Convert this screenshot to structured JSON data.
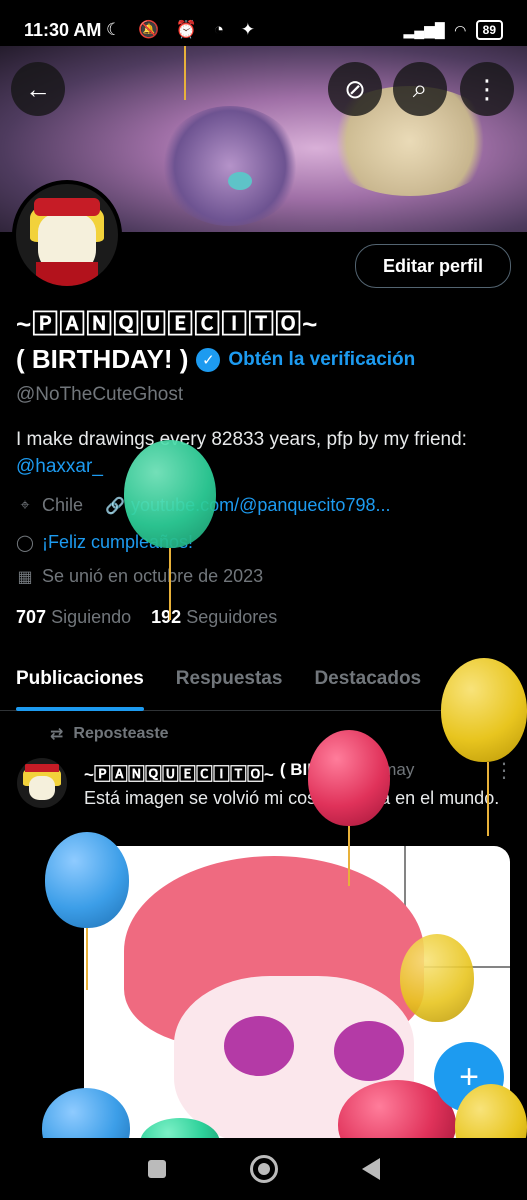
{
  "status_bar": {
    "time": "11:30 AM",
    "left_icons": [
      "moon-icon",
      "bell-off-icon",
      "alarm-icon",
      "whatsapp-icon",
      "game-icon"
    ],
    "battery": "89"
  },
  "top_buttons": {
    "back_icon": "←",
    "hide_icon": "⊘",
    "search_icon": "⌕",
    "more_icon": "⋮"
  },
  "profile": {
    "edit_label": "Editar perfil",
    "name_line1": "~🄿🄰🄽🅀🅄🄴🄲🄸🅃🄾~",
    "name_line2": "( BIRTHDAY! )",
    "verified_icon": "✓",
    "verify_link": "Obtén la verificación",
    "handle": "@NoTheCuteGhost",
    "bio_text": "I make drawings every 82833 years, pfp by my friend:",
    "bio_mention": "@haxxar_",
    "location": "Chile",
    "website": "youtube.com/@panquecito798...",
    "birthday": "¡Feliz cumpleaños!",
    "joined": "Se unió en octubre de 2023",
    "following_count": "707",
    "following_label": "Siguiendo",
    "followers_count": "192",
    "followers_label": "Seguidores"
  },
  "tabs": [
    "Publicaciones",
    "Respuestas",
    "Destacados",
    "Artíc"
  ],
  "post": {
    "repost_label": "Reposteaste",
    "author": "~🄿🄰🄽🅀🅄🄴🄲🄸🅃🄾~",
    "author_suffix": "( BIRT...",
    "date": "· 28 may",
    "text": "Está imagen se volvió mi cosa favorita en el mundo."
  },
  "fab": {
    "icon": "+"
  },
  "colors": {
    "accent": "#1d9bf0",
    "background": "#000000",
    "muted": "#71767b",
    "balloon_green": "#2ed19a",
    "balloon_yellow": "#e8c51f",
    "balloon_red": "#e0325a",
    "balloon_blue": "#3c9ee8"
  }
}
